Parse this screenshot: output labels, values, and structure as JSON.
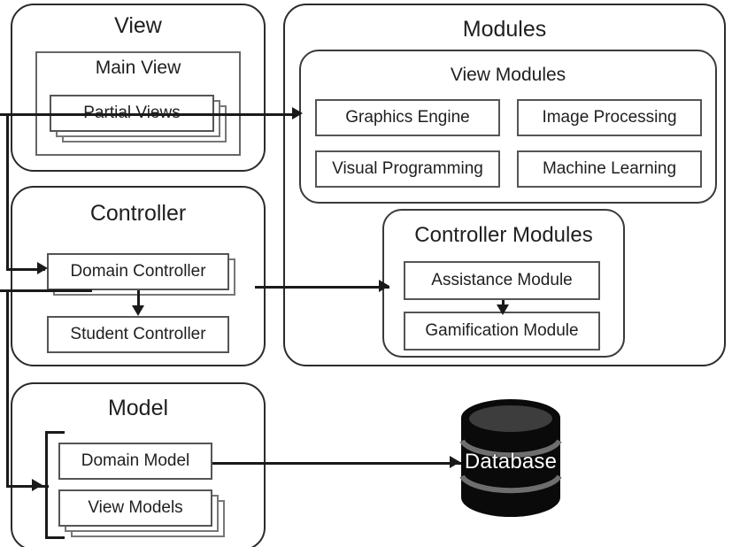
{
  "diagram": {
    "title": "MVC Architecture with Modules and Database",
    "colors": {
      "line": "#1a1a1a",
      "box_border": "#555555",
      "group_border": "#2b2b2b",
      "database_body": "#0a0a0a",
      "database_top": "#3d3d3d",
      "database_band": "#6e6e6e",
      "background": "#ffffff",
      "text": "#1f1f1f",
      "database_text": "#ffffff"
    }
  },
  "view_group": {
    "title": "View",
    "main_view": {
      "title": "Main View",
      "partial_views": "Partial Views"
    }
  },
  "controller_group": {
    "title": "Controller",
    "domain_controller": "Domain Controller",
    "student_controller": "Student Controller"
  },
  "model_group": {
    "title": "Model",
    "domain_model": "Domain Model",
    "view_models": "View Models"
  },
  "modules_group": {
    "title": "Modules",
    "view_modules": {
      "title": "View Modules",
      "items": [
        "Graphics Engine",
        "Image Processing",
        "Visual Programming",
        "Machine Learning"
      ]
    },
    "controller_modules": {
      "title": "Controller Modules",
      "items": [
        "Assistance Module",
        "Gamification Module"
      ]
    }
  },
  "database": {
    "label": "Database"
  },
  "connections": [
    {
      "from": "Partial Views",
      "to": "View Modules",
      "type": "arrow"
    },
    {
      "from": "View",
      "to": "Domain Controller",
      "type": "arrow"
    },
    {
      "from": "Domain Controller",
      "to": "Student Controller",
      "type": "arrow"
    },
    {
      "from": "Controller",
      "to": "Controller Modules",
      "type": "arrow"
    },
    {
      "from": "Assistance Module",
      "to": "Gamification Module",
      "type": "arrow"
    },
    {
      "from": "Controller",
      "to": "Model",
      "type": "arrow"
    },
    {
      "from": "Domain Model",
      "to": "Database",
      "type": "arrow"
    }
  ]
}
